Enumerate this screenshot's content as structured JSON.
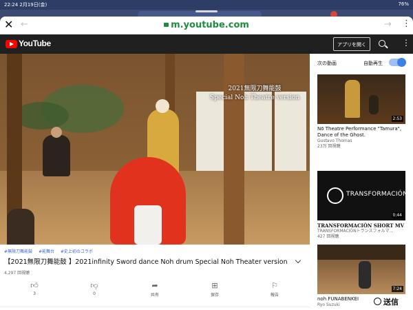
{
  "status_bar": {
    "time": "22:24  2月19日(金)",
    "battery": "76%"
  },
  "browser": {
    "close_glyph": "✕",
    "url": "m.youtube.com",
    "back_glyph": "←",
    "forward_glyph": "→",
    "menu_glyph": "⋮"
  },
  "youtube": {
    "logo_text": "YouTube",
    "open_app": "アプリを開く",
    "video": {
      "overlay_title": "2021無限刀舞能鼓",
      "overlay_subtitle": "Special Noh Theatre version",
      "tags": [
        "#無限刀舞能鼓",
        "#能舞台",
        "#史上初のコラボ"
      ],
      "title": "【2021無限刀舞能鼓 】2021infinity Sword dance Noh drum Special Noh Theater version",
      "views": "4,297 回視聴"
    },
    "actions": {
      "like": "3",
      "dislike": "0",
      "share": "共有",
      "save": "保存",
      "report": "報告"
    },
    "sidebar": {
      "heading": "次の動画",
      "autoplay": "自動再生",
      "autoplay_on": true,
      "videos": [
        {
          "duration": "2:53",
          "title": "Nō Theatre Performance \"Tamura\", Dance of the Ghost.",
          "channel": "Gustavo Thomas",
          "views": "23万 回視聴"
        },
        {
          "duration": "0:44",
          "title": "TRANSFORMACIÓN SHORT MV",
          "channel": "TRANSFORMACIÓNトランスフォルマ...",
          "views": "427 回視聴",
          "thumb_text": "TRANSFORMACIÓN"
        },
        {
          "duration": "7:24",
          "title": "noh FUNABENKEI",
          "channel": "Ryo Suzuki",
          "views": ""
        }
      ]
    }
  },
  "send_button": "送信"
}
